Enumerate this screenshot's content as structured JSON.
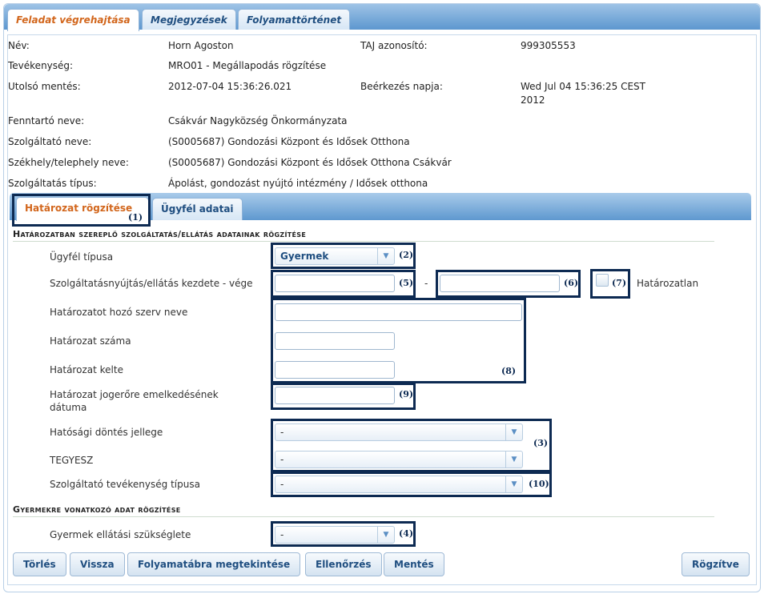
{
  "tabs": [
    "Feladat végrehajtása",
    "Megjegyzések",
    "Folyamattörténet"
  ],
  "info": {
    "nev_label": "Név:",
    "nev": "Horn Agoston",
    "taj_label": "TAJ azonosító:",
    "taj": "999305553",
    "tev_label": "Tevékenység:",
    "tev": "MRO01 - Megállapodás rögzítése",
    "ment_label": "Utolsó mentés:",
    "ment": "2012-07-04 15:36:26.021",
    "beerk_label": "Beérkezés napja:",
    "beerk_1": "Wed Jul 04 15:36:25 CEST",
    "beerk_2": "2012",
    "fenn_label": "Fenntartó neve:",
    "fenn": "Csákvár Nagyközség Önkormányzata",
    "szolg_label": "Szolgáltató neve:",
    "szolg": "(S0005687) Gondozási Központ és Idősek Otthona",
    "szekh_label": "Székhely/telephely neve:",
    "szekh": "(S0005687) Gondozási Központ és Idősek Otthona Csákvár",
    "tipus_label": "Szolgáltatás típus:",
    "tipus": "Ápolást, gondozást nyújtó intézmény / Idősek otthona"
  },
  "subtabs": [
    "Határozat rögzítése",
    "Ügyfél adatai"
  ],
  "section1": "Határozatban szereplő szolgáltatás/ellátás adatainak rögzítése",
  "section2": "Gyermekre vonatkozó adat rögzítése",
  "fields": {
    "ugyfel_tipusa": "Ügyfél típusa",
    "ugyfel_tipusa_value": "Gyermek",
    "kezdete_vege": "Szolgáltatásnyújtás/ellátás kezdete - vége",
    "dash": "-",
    "hatarozatlan": "Határozatlan",
    "szerv_neve": "Határozatot hozó szerv neve",
    "hat_szama": "Határozat száma",
    "hat_kelte": "Határozat kelte",
    "jogerore_1": "Határozat jogerőre emelkedésének",
    "jogerore_2": "dátuma",
    "dontes_jellege": "Hatósági döntés jellege",
    "dontes_value": "-",
    "tegyesz": "TEGYESZ",
    "tegyesz_value": "-",
    "tev_tipusa": "Szolgáltató tevékenység típusa",
    "tev_tipusa_value": "-",
    "ellatasi": "Gyermek ellátási szükséglete",
    "ellatasi_value": "-"
  },
  "annotations": [
    "(1)",
    "(2)",
    "(5)",
    "(6)",
    "(7)",
    "(8)",
    "(9)",
    "(3)",
    "(10)",
    "(4)"
  ],
  "buttons": {
    "torles": "Törlés",
    "vissza": "Vissza",
    "folyamatabra": "Folyamatábra megtekintése",
    "ellenorzes": "Ellenőrzés",
    "mentes": "Mentés",
    "rogzitve": "Rögzítve"
  },
  "icons": {
    "dropdown": "chevron-down-icon"
  }
}
